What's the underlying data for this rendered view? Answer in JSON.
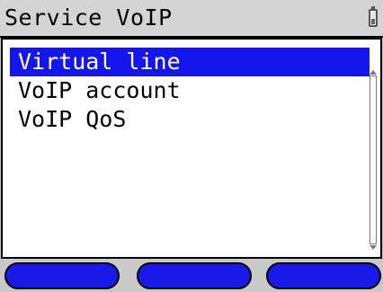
{
  "header": {
    "title": "Service VoIP",
    "battery_icon": "battery-icon"
  },
  "menu": {
    "items": [
      {
        "label": "Virtual line",
        "selected": true
      },
      {
        "label": "VoIP account",
        "selected": false
      },
      {
        "label": "VoIP QoS",
        "selected": false
      }
    ]
  },
  "softkeys": {
    "left": "",
    "center": "",
    "right": ""
  },
  "colors": {
    "selection": "#1515ee",
    "softkey": "#1a1ae8",
    "background": "#c9c9c9"
  }
}
